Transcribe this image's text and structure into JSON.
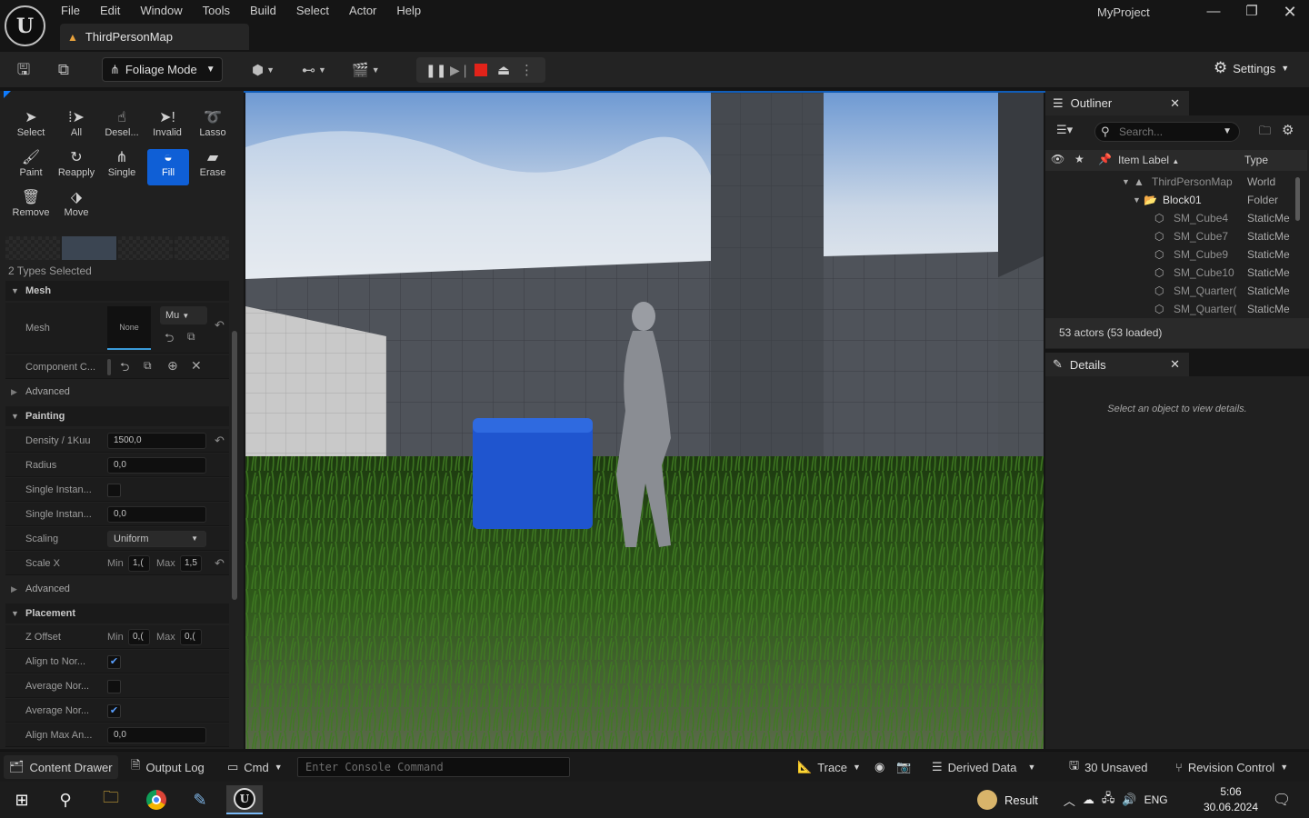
{
  "window": {
    "project": "MyProject",
    "map_tab": "ThirdPersonMap",
    "menu": [
      "File",
      "Edit",
      "Window",
      "Tools",
      "Build",
      "Select",
      "Actor",
      "Help"
    ]
  },
  "toolbar": {
    "mode": "Foliage Mode",
    "settings": "Settings"
  },
  "foliage": {
    "tools": [
      {
        "label": "Select",
        "icon": "cursor-icon",
        "active": false
      },
      {
        "label": "All",
        "icon": "select-all-icon",
        "active": false
      },
      {
        "label": "Desel...",
        "icon": "deselect-icon",
        "active": false
      },
      {
        "label": "Invalid",
        "icon": "invalid-icon",
        "active": false
      },
      {
        "label": "Lasso",
        "icon": "lasso-icon",
        "active": false
      },
      {
        "label": "Paint",
        "icon": "brush-icon",
        "active": false
      },
      {
        "label": "Reapply",
        "icon": "reapply-icon",
        "active": false
      },
      {
        "label": "Single",
        "icon": "single-icon",
        "active": false
      },
      {
        "label": "Fill",
        "icon": "fill-icon",
        "active": true
      },
      {
        "label": "Erase",
        "icon": "eraser-icon",
        "active": false
      },
      {
        "label": "Remove",
        "icon": "trash-icon",
        "active": false
      },
      {
        "label": "Move",
        "icon": "move-icon",
        "active": false
      }
    ],
    "types_selected": "2 Types Selected",
    "mesh_section": "Mesh",
    "mesh_label": "Mesh",
    "mesh_value": "None",
    "mesh_dropdown": "Mu",
    "component_label": "Component C...",
    "advanced_1": "Advanced",
    "painting_section": "Painting",
    "density_label": "Density / 1Kuu",
    "density_value": "1500,0",
    "radius_label": "Radius",
    "radius_value": "0,0",
    "single_instance_1_label": "Single Instan...",
    "single_instance_2_label": "Single Instan...",
    "single_instance_2_value": "0,0",
    "scaling_label": "Scaling",
    "scaling_value": "Uniform",
    "scale_x_label": "Scale X",
    "scale_x_min_label": "Min",
    "scale_x_min": "1,(",
    "scale_x_max_label": "Max",
    "scale_x_max": "1,5",
    "advanced_2": "Advanced",
    "placement_section": "Placement",
    "z_offset_label": "Z Offset",
    "z_offset_min_label": "Min",
    "z_offset_min": "0,(",
    "z_offset_max_label": "Max",
    "z_offset_max": "0,(",
    "align_to_normal_label": "Align to Nor...",
    "align_to_normal_checked": true,
    "average_normal_label": "Average Nor...",
    "average_normal_checked": false,
    "average_normal_2_label": "Average Nor...",
    "average_normal_2_checked": true,
    "align_max_label": "Align Max An...",
    "align_max_value": "0,0"
  },
  "outliner": {
    "title": "Outliner",
    "search_placeholder": "Search...",
    "col_label": "Item Label",
    "col_type": "Type",
    "rows": [
      {
        "label": "ThirdPersonMap",
        "type": "World",
        "icon": "map-icon"
      },
      {
        "label": "Block01",
        "type": "Folder",
        "icon": "folder-icon"
      },
      {
        "label": "SM_Cube4",
        "type": "StaticMe",
        "icon": "static-mesh-icon"
      },
      {
        "label": "SM_Cube7",
        "type": "StaticMe",
        "icon": "static-mesh-icon"
      },
      {
        "label": "SM_Cube9",
        "type": "StaticMe",
        "icon": "static-mesh-icon"
      },
      {
        "label": "SM_Cube10",
        "type": "StaticMe",
        "icon": "static-mesh-icon"
      },
      {
        "label": "SM_Quarter(",
        "type": "StaticMe",
        "icon": "static-mesh-icon"
      },
      {
        "label": "SM_Quarter(",
        "type": "StaticMe",
        "icon": "static-mesh-icon"
      }
    ],
    "actor_count": "53 actors (53 loaded)"
  },
  "details": {
    "title": "Details",
    "empty_message": "Select an object to view details."
  },
  "statusbar": {
    "content_drawer": "Content Drawer",
    "output_log": "Output Log",
    "cmd": "Cmd",
    "console_placeholder": "Enter Console Command",
    "trace": "Trace",
    "derived_data": "Derived Data",
    "unsaved": "30 Unsaved",
    "revision_control": "Revision Control"
  },
  "taskbar": {
    "result": "Result",
    "language": "ENG",
    "time": "5:06",
    "date": "30.06.2024"
  },
  "colors": {
    "accent": "#0f5fd6",
    "stop": "#e2231a",
    "panel": "#202020"
  }
}
